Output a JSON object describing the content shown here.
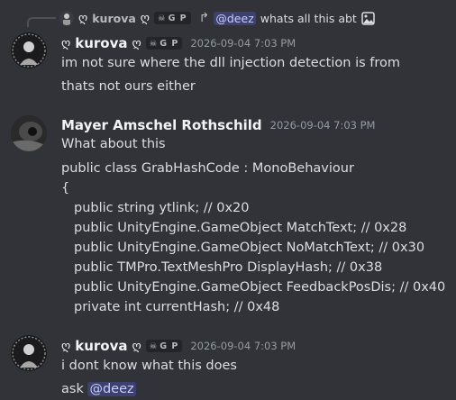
{
  "reply": {
    "author": "kurova",
    "badge": "G P",
    "mention": "@deez",
    "text": "whats all this abt",
    "attachment_icon": "image-icon"
  },
  "messages": [
    {
      "author": "kurova",
      "badge": "G P",
      "timestamp": "2026-09-04 7:03 PM",
      "lines": [
        "im not sure where the dll injection detection is from",
        "thats not ours either"
      ]
    },
    {
      "author": "Mayer Amschel Rothschild",
      "timestamp": "2026-09-04 7:03 PM",
      "lines": [
        "What about this",
        "public class GrabHashCode : MonoBehaviour",
        "{",
        "public string ytlink; // 0x20",
        "public UnityEngine.GameObject MatchText; // 0x28",
        "public UnityEngine.GameObject NoMatchText; // 0x30",
        "public TMPro.TextMeshPro DisplayHash; // 0x38",
        "public UnityEngine.GameObject FeedbackPosDis; // 0x40",
        "private int currentHash; // 0x48"
      ]
    },
    {
      "author": "kurova",
      "badge": "G P",
      "timestamp": "2026-09-04 7:03 PM",
      "lines": [
        "i dont know what this does",
        "ask"
      ],
      "mention": "@deez"
    }
  ],
  "colors": {
    "background": "#313338",
    "text": "#dbdee1",
    "muted": "#949ba4",
    "mention_bg": "#5865f2"
  }
}
